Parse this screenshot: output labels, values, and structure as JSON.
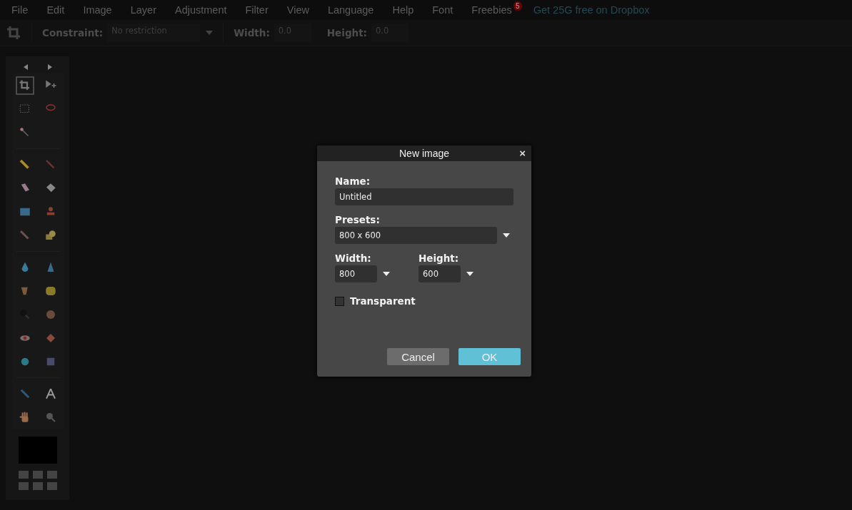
{
  "menu": [
    {
      "label": "File"
    },
    {
      "label": "Edit"
    },
    {
      "label": "Image"
    },
    {
      "label": "Layer"
    },
    {
      "label": "Adjustment"
    },
    {
      "label": "Filter"
    },
    {
      "label": "View"
    },
    {
      "label": "Language"
    },
    {
      "label": "Help"
    },
    {
      "label": "Font"
    },
    {
      "label": "Freebies",
      "badge": "5"
    }
  ],
  "promo_link": "Get 25G free on Dropbox",
  "toolbar": {
    "constraint_label": "Constraint:",
    "constraint_value": "No restriction",
    "width_label": "Width:",
    "width_value": "0.0",
    "height_label": "Height:",
    "height_value": "0.0"
  },
  "tools": [
    {
      "selected": true
    },
    {
      "selected": false
    },
    {
      "selected": false
    },
    {
      "selected": false
    },
    {
      "selected": false
    },
    {
      "selected": false
    },
    {
      "selected": false
    },
    {
      "selected": false
    },
    {
      "selected": false
    },
    {
      "selected": false
    },
    {
      "selected": false
    },
    {
      "selected": false
    },
    {
      "selected": false
    },
    {
      "selected": false
    },
    {
      "selected": false
    },
    {
      "selected": false
    },
    {
      "selected": false
    },
    {
      "selected": false
    },
    {
      "selected": false
    },
    {
      "selected": false
    },
    {
      "selected": false
    },
    {
      "selected": false
    },
    {
      "selected": false
    },
    {
      "selected": false
    },
    {
      "selected": false
    },
    {
      "selected": false
    },
    {
      "selected": false
    }
  ],
  "dialog": {
    "title": "New image",
    "close": "×",
    "name_label": "Name:",
    "name_value": "Untitled",
    "presets_label": "Presets:",
    "presets_value": "800 x 600",
    "width_label": "Width:",
    "width_value": "800",
    "height_label": "Height:",
    "height_value": "600",
    "transparent_label": "Transparent",
    "transparent_checked": false,
    "buttons": [
      {
        "label": "Cancel",
        "kind": "secondary"
      },
      {
        "label": "OK",
        "kind": "primary"
      }
    ]
  }
}
